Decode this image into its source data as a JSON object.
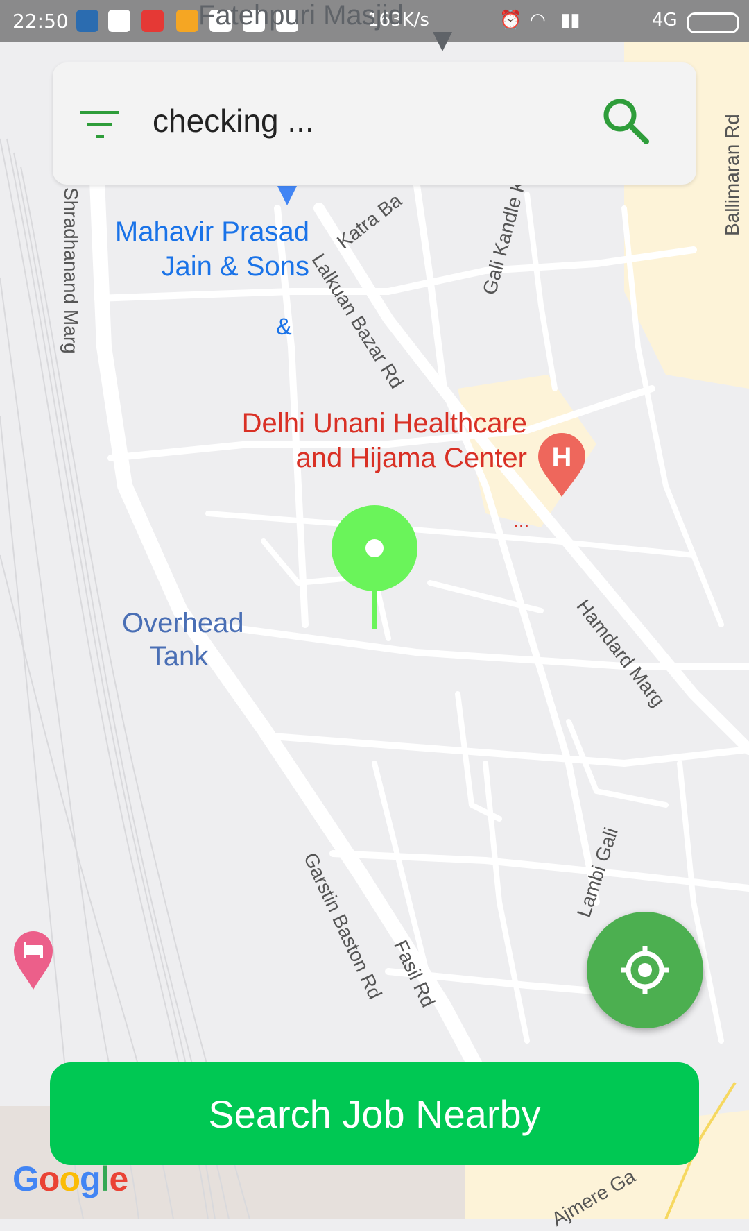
{
  "status_bar": {
    "time": "22:50",
    "network_speed": "163K/s",
    "network_type": "4G"
  },
  "search": {
    "query": "checking ...",
    "filter_icon": "filter-icon",
    "search_icon": "search-icon"
  },
  "map": {
    "poi_labels": {
      "mahavir_line1": "Mahavir Prasad",
      "mahavir_line2": "Jain & Sons",
      "ampersand": "&",
      "unani_line1": "Delhi Unani Healthcare",
      "unani_line2": "and Hijama Center",
      "overhead_line1": "Overhead",
      "overhead_line2": "Tank",
      "fatehpuri": "Fatehpuri Masjid",
      "dots": "..."
    },
    "streets": {
      "shradhanand": "Shradhanand Marg",
      "lalkuan": "Lalkuan Bazar Rd",
      "katra": "Katra Ba",
      "gali_kandle": "Gali Kandle K",
      "ballimaran": "Ballimaran Rd",
      "hamdard": "Hamdard Marg",
      "lambi": "Lambi Gali",
      "garstin": "Garstin Baston Rd",
      "fasil": "Fasil Rd",
      "ajmere": "Ajmere Ga"
    },
    "colors": {
      "background": "#eeeef0",
      "road": "#ffffff",
      "highlight_area": "#fdf3d8",
      "poi_blue": "#1a73e8",
      "poi_red": "#d93025",
      "pin_green": "#6af45a"
    },
    "attribution": "Google"
  },
  "fab": {
    "icon": "my-location-icon"
  },
  "cta": {
    "label": "Search Job Nearby",
    "color": "#00c853"
  }
}
